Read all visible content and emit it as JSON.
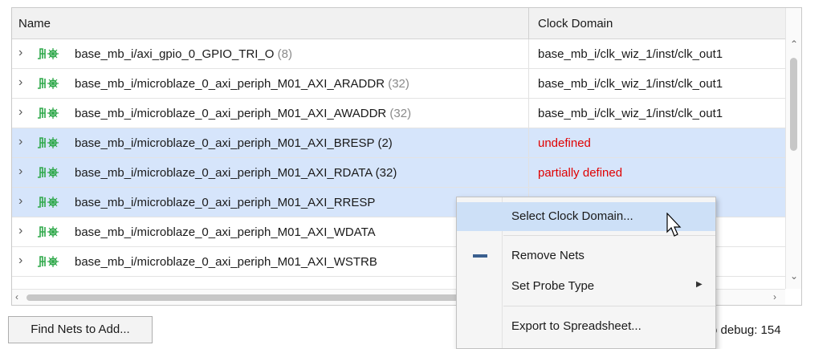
{
  "table": {
    "headers": {
      "name": "Name",
      "clock_domain": "Clock Domain"
    },
    "rows": [
      {
        "name": "base_mb_i/axi_gpio_0_GPIO_TRI_O",
        "count": "(8)",
        "domain": "base_mb_i/clk_wiz_1/inst/clk_out1",
        "selected": false,
        "domain_status": "defined"
      },
      {
        "name": "base_mb_i/microblaze_0_axi_periph_M01_AXI_ARADDR",
        "count": "(32)",
        "domain": "base_mb_i/clk_wiz_1/inst/clk_out1",
        "selected": false,
        "domain_status": "defined"
      },
      {
        "name": "base_mb_i/microblaze_0_axi_periph_M01_AXI_AWADDR",
        "count": "(32)",
        "domain": "base_mb_i/clk_wiz_1/inst/clk_out1",
        "selected": false,
        "domain_status": "defined"
      },
      {
        "name": "base_mb_i/microblaze_0_axi_periph_M01_AXI_BRESP",
        "count": "(2)",
        "domain": "undefined",
        "selected": true,
        "domain_status": "undefined"
      },
      {
        "name": "base_mb_i/microblaze_0_axi_periph_M01_AXI_RDATA",
        "count": "(32)",
        "domain": "partially defined",
        "selected": true,
        "domain_status": "partial"
      },
      {
        "name": "base_mb_i/microblaze_0_axi_periph_M01_AXI_RRESP",
        "count": "",
        "domain": "",
        "selected": true,
        "domain_status": ""
      },
      {
        "name": "base_mb_i/microblaze_0_axi_periph_M01_AXI_WDATA",
        "count": "",
        "domain": "st/clk_out1",
        "selected": false,
        "domain_status": "defined"
      },
      {
        "name": "base_mb_i/microblaze_0_axi_periph_M01_AXI_WSTRB",
        "count": "",
        "domain": "st/clk_out1",
        "selected": false,
        "domain_status": "defined"
      }
    ]
  },
  "context_menu": {
    "items": [
      {
        "label": "Select Clock Domain...",
        "highlighted": true
      },
      {
        "label": "Remove Nets",
        "icon": "minus-icon"
      },
      {
        "label": "Set Probe Type",
        "submenu": true
      },
      {
        "label": "Export to Spreadsheet..."
      }
    ]
  },
  "footer": {
    "find_button": "Find Nets to Add...",
    "count_text": "o debug: 154"
  },
  "colors": {
    "selection": "#d6e5fb",
    "menu_highlight": "#cde0f7",
    "error_text": "#e00000",
    "signal_icon": "#2ea84a"
  },
  "icons": [
    "expand-chevron-icon",
    "signal-net-icon",
    "minus-icon",
    "submenu-arrow-icon",
    "mouse-cursor-icon"
  ]
}
